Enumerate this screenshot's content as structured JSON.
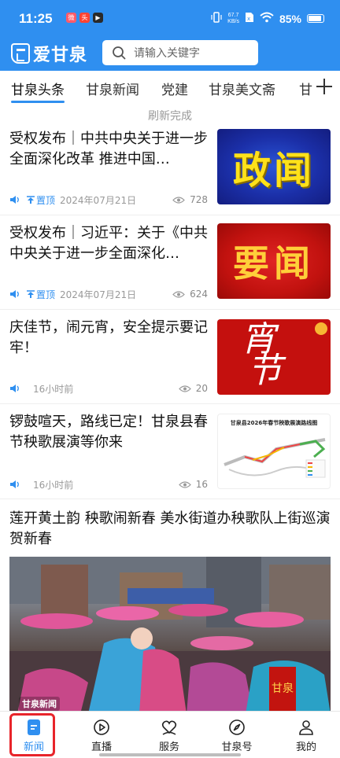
{
  "status_bar": {
    "time": "11:25",
    "net_speed_value": "67.7",
    "net_speed_unit": "KB/s",
    "battery": "85%"
  },
  "header": {
    "app_name": "爱甘泉",
    "search_placeholder": "请输入关键字"
  },
  "tabs": [
    {
      "label": "甘泉头条",
      "active": true
    },
    {
      "label": "甘泉新闻"
    },
    {
      "label": "党建"
    },
    {
      "label": "甘泉美文斋"
    },
    {
      "label": "甘"
    }
  ],
  "refresh_status": "刷新完成",
  "news": [
    {
      "title": "受权发布｜中共中央关于进一步全面深化改革 推进中国…",
      "pinned_label": "置顶",
      "date": "2024年07月21日",
      "views": "728",
      "thumb_text": "政闻"
    },
    {
      "title": "受权发布｜习近平：关于《中共中央关于进一步全面深化…",
      "pinned_label": "置顶",
      "date": "2024年07月21日",
      "views": "624",
      "thumb_text": "要闻"
    },
    {
      "title": "庆佳节，闹元宵，安全提示要记牢！",
      "time": "16小时前",
      "views": "20",
      "thumb_text_1": "宵",
      "thumb_text_2": "节"
    },
    {
      "title": "锣鼓喧天，路线已定！甘泉县春节秧歌展演等你来",
      "time": "16小时前",
      "views": "16",
      "thumb_title": "甘泉县2026年春节秧歌展演路线图"
    },
    {
      "title": "莲开黄土韵 秧歌闹新春 美水街道办秧歌队上街巡演贺新春",
      "video_caption": "甘泉新闻"
    }
  ],
  "bottom_nav": [
    {
      "label": "新闻",
      "icon": "news-icon",
      "active": true
    },
    {
      "label": "直播",
      "icon": "live-play-icon"
    },
    {
      "label": "服务",
      "icon": "service-heart-icon"
    },
    {
      "label": "甘泉号",
      "icon": "compass-icon"
    },
    {
      "label": "我的",
      "icon": "profile-icon"
    }
  ],
  "colors": {
    "brand_blue": "#2f8ff0",
    "highlight_red": "#e8242a"
  }
}
